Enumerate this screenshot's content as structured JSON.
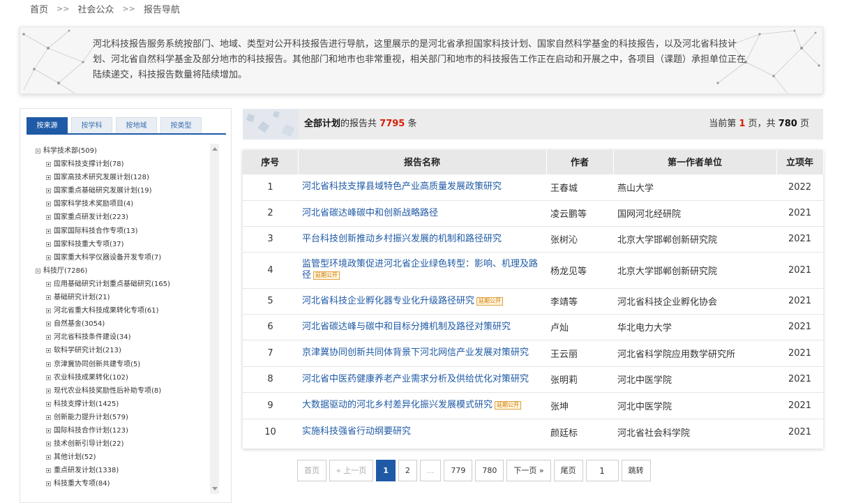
{
  "breadcrumb": {
    "home": "首页",
    "sep": ">>",
    "level1": "社会公众",
    "level2": "报告导航"
  },
  "intro": {
    "text": "河北科技报告服务系统按部门、地域、类型对公开科技报告进行导航，这里展示的是河北省承担国家科技计划、国家自然科学基金的科技报告，以及河北省科技计划、河北省自然科学基金及部分地市的科技报告。其他部门和地市也非常重视，相关部门和地市的科技报告工作正在启动和开展之中，各项目（课题）承担单位正在陆续递交，科技报告数量将陆续增加。"
  },
  "tabs": [
    "按来源",
    "按学科",
    "按地域",
    "按类型"
  ],
  "tree": [
    {
      "label": "科学技术部(509)",
      "expanded": true,
      "children": [
        "国家科技支撑计划(78)",
        "国家高技术研究发展计划(128)",
        "国家重点基础研究发展计划(19)",
        "国家科学技术奖励项目(4)",
        "国家重点研发计划(223)",
        "国家国际科技合作专项(13)",
        "国家科技重大专项(37)",
        "国家重大科学仪器设备开发专项(7)"
      ]
    },
    {
      "label": "科技厅(7286)",
      "expanded": true,
      "children": [
        "应用基础研究计划重点基础研究(165)",
        "基础研究计划(21)",
        "河北省重大科技成果转化专项(61)",
        "自然基金(3054)",
        "河北省科技条件建设(34)",
        "软科学研究计划(213)",
        "京津冀协同创新共建专项(5)",
        "农业科技成果转化(102)",
        "现代农业科技奖励性后补助专项(8)",
        "科技支撑计划(1425)",
        "创新能力提升计划(579)",
        "国际科技合作计划(123)",
        "技术创新引导计划(22)",
        "其他计划(52)",
        "重点研发计划(1338)",
        "科技重大专项(84)"
      ]
    }
  ],
  "summary": {
    "plan": "全部计划",
    "mid": "的报告共",
    "count": "7795",
    "unit": "条",
    "page_prefix": "当前第",
    "current": "1",
    "page_mid": "页，共",
    "total": "780",
    "page_suffix": "页"
  },
  "table": {
    "headers": [
      "序号",
      "报告名称",
      "作者",
      "第一作者单位",
      "立项年"
    ],
    "badge": "延期公开",
    "rows": [
      {
        "no": "1",
        "title": "河北省科技支撑县域特色产业高质量发展政策研究",
        "delayed": false,
        "author": "王春城",
        "org": "燕山大学",
        "year": "2022"
      },
      {
        "no": "2",
        "title": "河北省碳达峰碳中和创新战略路径",
        "delayed": false,
        "author": "凌云鹏等",
        "org": "国网河北经研院",
        "year": "2021"
      },
      {
        "no": "3",
        "title": "平台科技创新推动乡村振兴发展的机制和路径研究",
        "delayed": false,
        "author": "张树沁",
        "org": "北京大学邯郸创新研究院",
        "year": "2021"
      },
      {
        "no": "4",
        "title": "监管型环境政策促进河北省企业绿色转型：影响、机理及路径",
        "delayed": true,
        "author": "杨龙见等",
        "org": "北京大学邯郸创新研究院",
        "year": "2021"
      },
      {
        "no": "5",
        "title": "河北省科技企业孵化器专业化升级路径研究",
        "delayed": true,
        "author": "李靖等",
        "org": "河北省科技企业孵化协会",
        "year": "2021"
      },
      {
        "no": "6",
        "title": "河北省碳达峰与碳中和目标分摊机制及路径对策研究",
        "delayed": false,
        "author": "卢灿",
        "org": "华北电力大学",
        "year": "2021"
      },
      {
        "no": "7",
        "title": "京津冀协同创新共同体背景下河北网信产业发展对策研究",
        "delayed": false,
        "author": "王云丽",
        "org": "河北省科学院应用数学研究所",
        "year": "2021"
      },
      {
        "no": "8",
        "title": "河北省中医药健康养老产业需求分析及供给优化对策研究",
        "delayed": false,
        "author": "张明莉",
        "org": "河北中医学院",
        "year": "2021"
      },
      {
        "no": "9",
        "title": "大数据驱动的河北乡村差异化振兴发展模式研究",
        "delayed": true,
        "author": "张坤",
        "org": "河北中医学院",
        "year": "2021"
      },
      {
        "no": "10",
        "title": "实施科技强省行动纲要研究",
        "delayed": false,
        "author": "颜廷标",
        "org": "河北省社会科学院",
        "year": "2021"
      }
    ]
  },
  "pager": {
    "first": "首页",
    "prev": "« 上一页",
    "pages": [
      "1",
      "2",
      "...",
      "779",
      "780"
    ],
    "current": "1",
    "next": "下一页 »",
    "last": "尾页",
    "jump_value": "1",
    "jump": "跳转"
  },
  "colors": {
    "accent": "#1f5aa6",
    "count_red": "#d81e06",
    "badge": "#d07a00"
  },
  "icons": {
    "tree_toggle": "tree-toggle-icon"
  }
}
